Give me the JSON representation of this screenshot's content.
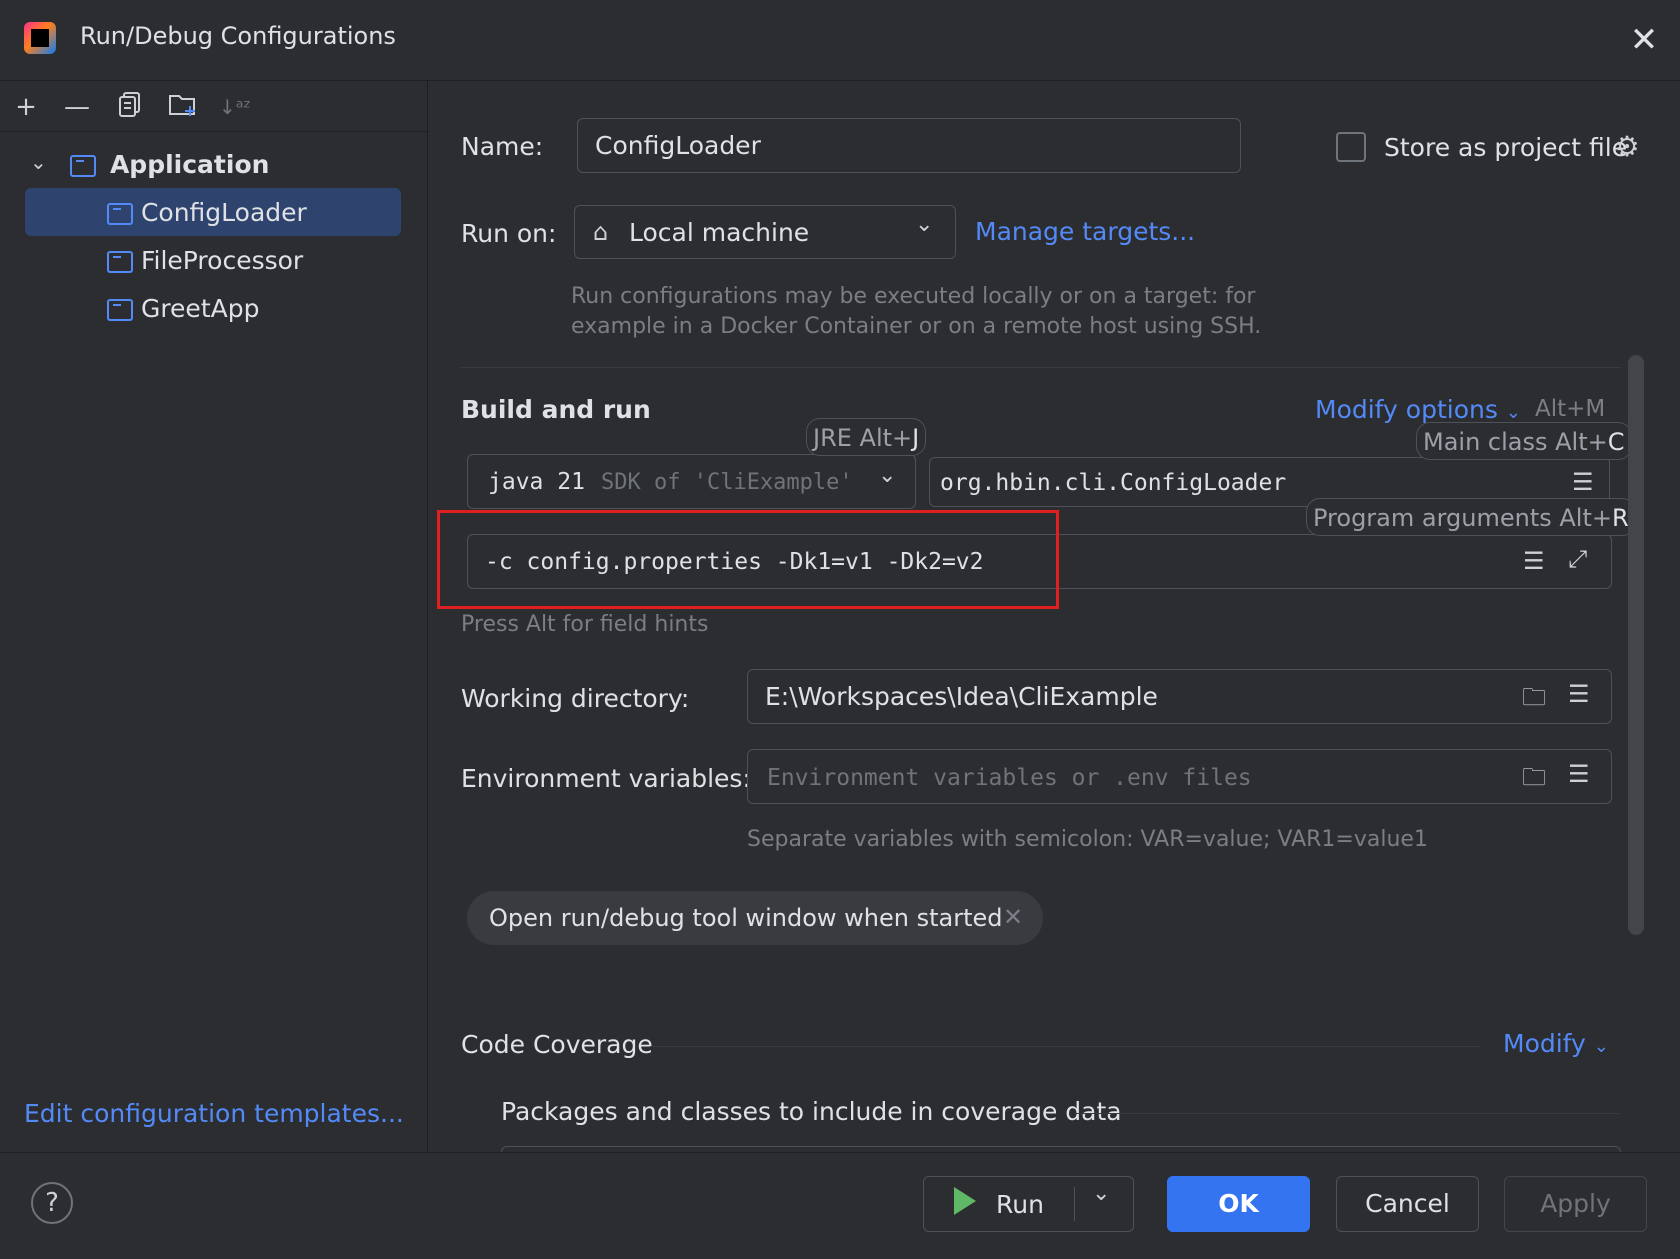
{
  "window": {
    "title": "Run/Debug Configurations"
  },
  "sidebar": {
    "root_label": "Application",
    "items": [
      {
        "label": "ConfigLoader",
        "selected": true
      },
      {
        "label": "FileProcessor"
      },
      {
        "label": "GreetApp"
      }
    ],
    "edit_templates": "Edit configuration templates..."
  },
  "form": {
    "name_label": "Name:",
    "name_value": "ConfigLoader",
    "store_label": "Store as project file",
    "run_on_label": "Run on:",
    "run_on_value": "Local machine",
    "manage_targets": "Manage targets...",
    "run_on_hint_1": "Run configurations may be executed locally or on a target: for",
    "run_on_hint_2": "example in a Docker Container or on a remote host using SSH.",
    "build_run_title": "Build and run",
    "modify_options": "Modify options",
    "modify_shortcut": "Alt+M",
    "jre_hint": "JRE Alt+",
    "jre_hint_key": "J",
    "main_class_hint": "Main class Alt+",
    "main_class_hint_key": "C",
    "program_args_hint": "Program arguments Alt+",
    "program_args_hint_key": "R",
    "jdk_value": "java 21",
    "jdk_detail": "SDK of 'CliExample'",
    "main_class_value": "org.hbin.cli.ConfigLoader",
    "program_args_value": "-c config.properties -Dk1=v1 -Dk2=v2",
    "field_hints": "Press Alt for field hints",
    "working_dir_label": "Working directory:",
    "working_dir_value": "E:\\Workspaces\\Idea\\CliExample",
    "env_label": "Environment variables:",
    "env_placeholder": "Environment variables or .env files",
    "env_hint": "Separate variables with semicolon: VAR=value; VAR1=value1",
    "open_tool_window": "Open run/debug tool window when started",
    "code_coverage_title": "Code Coverage",
    "coverage_modify": "Modify",
    "coverage_packages": "Packages and classes to include in coverage data"
  },
  "footer": {
    "help": "?",
    "run": "Run",
    "ok": "OK",
    "cancel": "Cancel",
    "apply": "Apply"
  },
  "colors": {
    "accent": "#3574f0",
    "link": "#548af7",
    "highlight_box": "#e02020"
  }
}
